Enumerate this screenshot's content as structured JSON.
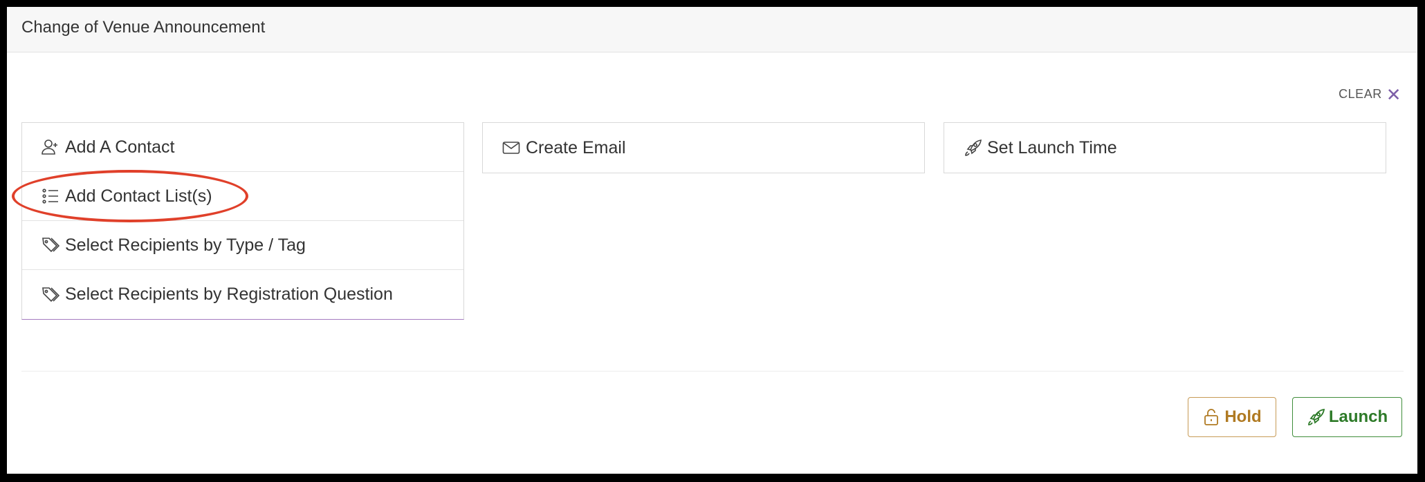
{
  "header": {
    "title": "Change of Venue Announcement"
  },
  "clear": {
    "label": "CLEAR",
    "icon": "close-icon"
  },
  "recipients": {
    "items": [
      {
        "label": "Add A Contact",
        "icon": "user-plus-icon"
      },
      {
        "label": "Add Contact List(s)",
        "icon": "list-icon"
      },
      {
        "label": "Select Recipients by Type / Tag",
        "icon": "tags-icon"
      },
      {
        "label": "Select Recipients by Registration Question",
        "icon": "tags-icon"
      }
    ]
  },
  "email": {
    "label": "Create Email",
    "icon": "envelope-icon"
  },
  "launch_time": {
    "label": "Set Launch Time",
    "icon": "rocket-icon"
  },
  "actions": {
    "hold_label": "Hold",
    "launch_label": "Launch"
  },
  "colors": {
    "accent": "#7d5fa8",
    "hold": "#b07a22",
    "launch": "#2d7a28",
    "highlight": "#e0402a"
  }
}
